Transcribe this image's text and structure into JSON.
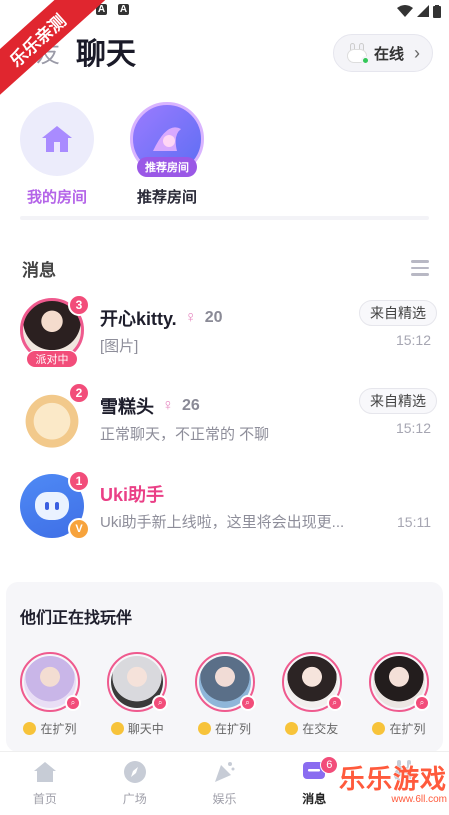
{
  "watermark": {
    "ribbon": "乐乐亲测",
    "logo": "乐乐游戏",
    "url": "www.6ll.com"
  },
  "statusbar": {
    "icons": [
      "signal-icon",
      "wifi-icon",
      "battery-icon"
    ]
  },
  "header": {
    "tab_partial": "友",
    "tab_active": "聊天",
    "status_label": "在线"
  },
  "rooms": [
    {
      "label": "我的房间"
    },
    {
      "label": "推荐房间",
      "badge": "推荐房间"
    }
  ],
  "messages_section": {
    "title": "消息"
  },
  "messages": [
    {
      "name": "开心kitty.",
      "level": "20",
      "preview": "[图片]",
      "tag": "来自精选",
      "time": "15:12",
      "unread": "3",
      "party": "派对中"
    },
    {
      "name": "雪糕头",
      "level": "26",
      "preview": "正常聊天，不正常的 不聊",
      "tag": "来自精选",
      "time": "15:12",
      "unread": "2"
    },
    {
      "name": "Uki助手",
      "preview": "Uki助手新上线啦，这里将会出现更...",
      "time": "15:11",
      "unread": "1",
      "vbadge": "V"
    }
  ],
  "find_panel": {
    "title": "他们正在找玩伴",
    "players": [
      {
        "status": "在扩列"
      },
      {
        "status": "聊天中"
      },
      {
        "status": "在扩列"
      },
      {
        "status": "在交友"
      },
      {
        "status": "在扩列"
      }
    ]
  },
  "bottom_nav": [
    {
      "label": "首页"
    },
    {
      "label": "广场"
    },
    {
      "label": "娱乐"
    },
    {
      "label": "消息",
      "badge": "6"
    },
    {
      "label": ""
    }
  ],
  "colors": {
    "accent_pink": "#f24d7a",
    "accent_purple": "#9a58e6",
    "name_pink": "#ea3f86"
  }
}
